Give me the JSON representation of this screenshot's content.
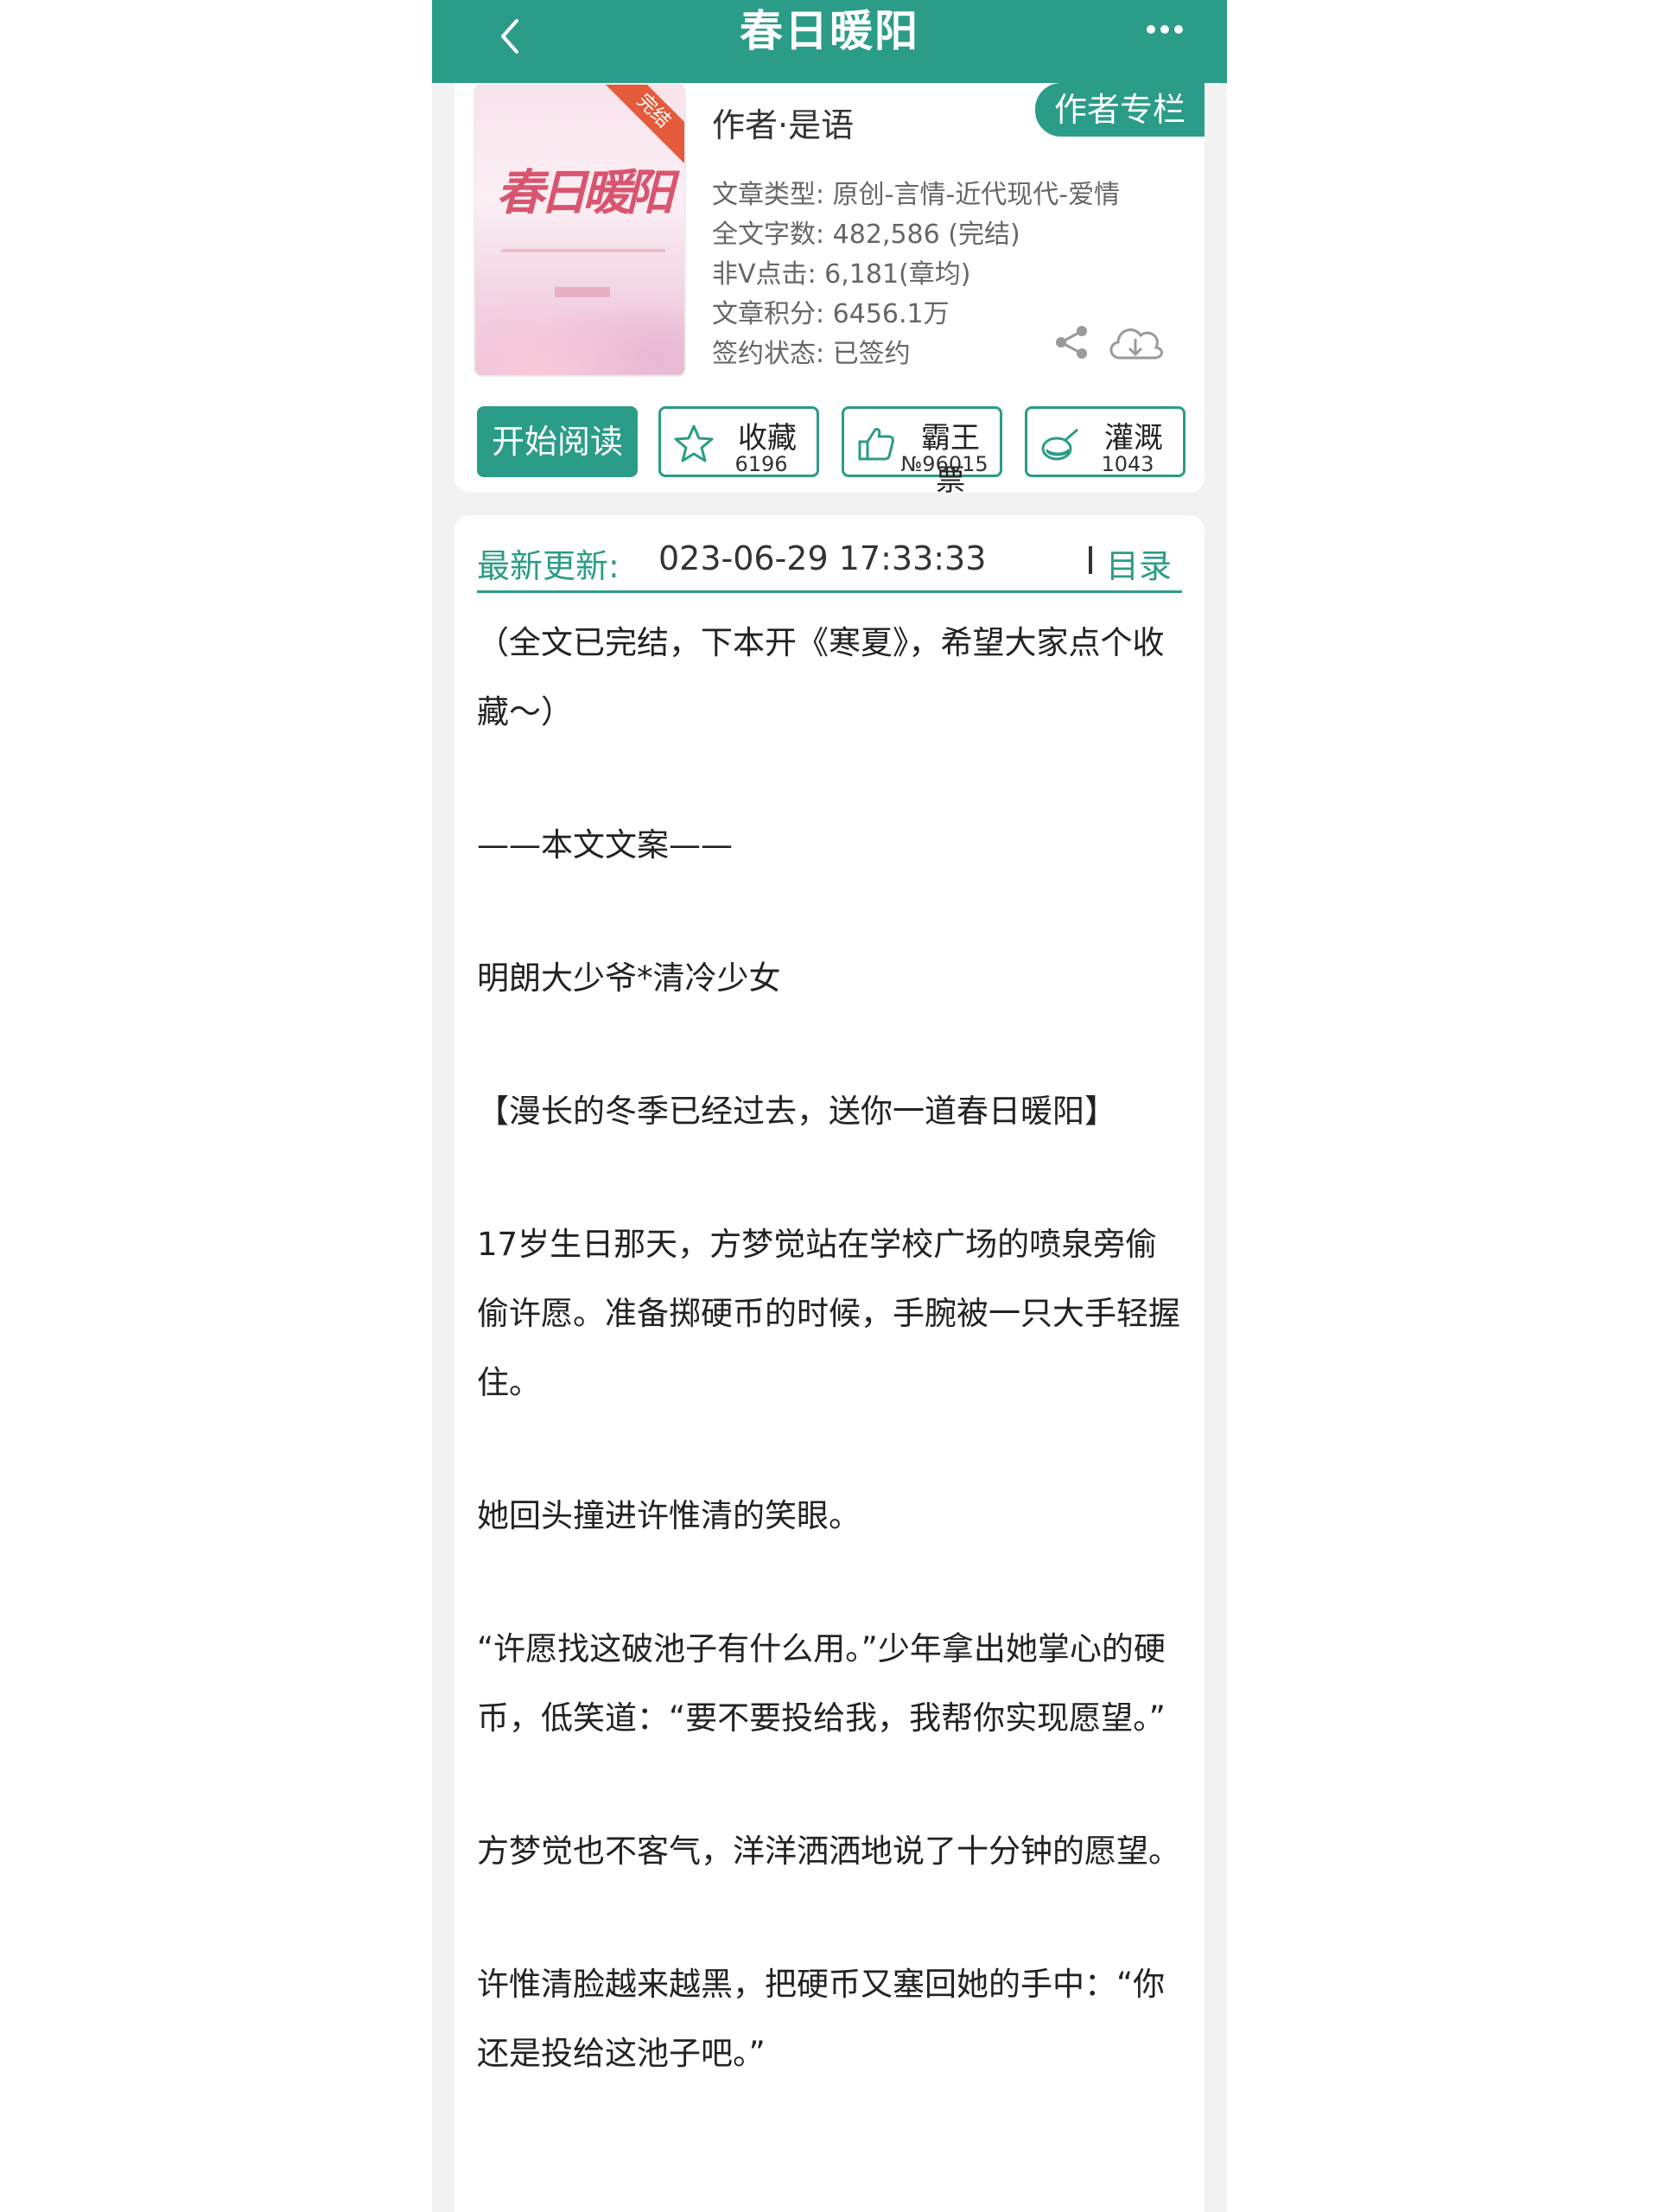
{
  "header": {
    "title": "春日暖阳"
  },
  "book": {
    "cover_title": "春日暖阳",
    "status_ribbon": "完结",
    "author": "作者·是语",
    "author_column_label": "作者专栏",
    "type": "文章类型: 原创-言情-近代现代-爱情",
    "word_count": "全文字数: 482,586 (完结)",
    "non_v_clicks": "非V点击: 6,181(章均)",
    "score": "文章积分: 6456.1万",
    "contract": "签约状态:  已签约"
  },
  "actions": {
    "read_label": "开始阅读",
    "favorite_label": "收藏",
    "favorite_count": "6196",
    "vote_label": "霸王票",
    "vote_rank": "№96015",
    "water_label": "灌溉",
    "water_count": "1043"
  },
  "update": {
    "label": "最新更新:",
    "time": "023-06-29 17:33:33",
    "toc_label": "目录"
  },
  "blurb": [
    "（全文已完结，下本开《寒夏》，希望大家点个收藏～）",
    "——本文文案——",
    "明朗大少爷*清冷少女",
    "【漫长的冬季已经过去，送你一道春日暖阳】",
    "17岁生日那天，方梦觉站在学校广场的喷泉旁偷偷许愿。准备掷硬币的时候，手腕被一只大手轻握住。",
    "她回头撞进许惟清的笑眼。",
    "“许愿找这破池子有什么用。”少年拿出她掌心的硬币，低笑道：“要不要投给我，我帮你实现愿望。”",
    "方梦觉也不客气，洋洋洒洒地说了十分钟的愿望。",
    "许惟清脸越来越黑，把硬币又塞回她的手中：“你还是投给这池子吧。”"
  ],
  "colors": {
    "accent": "#2b9c87",
    "ribbon": "#e55a3a"
  }
}
